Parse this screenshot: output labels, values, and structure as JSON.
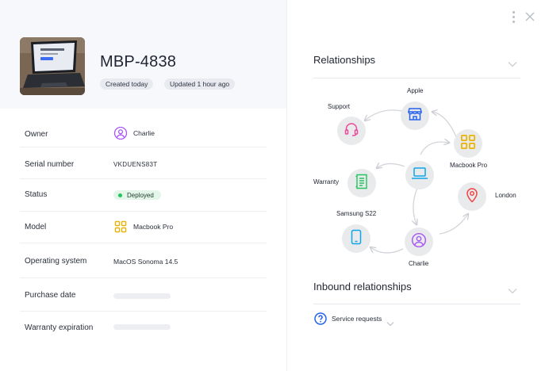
{
  "asset": {
    "title": "MBP-4838",
    "created_label": "Created today",
    "updated_label": "Updated 1 hour ago"
  },
  "fields": [
    {
      "label": "Owner",
      "value": "Charlie",
      "icon": "user-circle-icon"
    },
    {
      "label": "Serial number",
      "value": "VKDUENS83T"
    },
    {
      "label": "Status",
      "value": "Deployed",
      "status_color": "#22c55e"
    },
    {
      "label": "Model",
      "value": "Macbook Pro",
      "icon": "grid-icon"
    },
    {
      "label": "Operating system",
      "value": "MacOS Sonoma 14.5"
    },
    {
      "label": "Purchase date",
      "value": ""
    },
    {
      "label": "Warranty expiration",
      "value": ""
    }
  ],
  "relationships": {
    "title": "Relationships",
    "nodes": [
      {
        "label": "Apple",
        "icon": "store-icon"
      },
      {
        "label": "Support",
        "icon": "headset-icon"
      },
      {
        "label": "Macbook Pro",
        "icon": "grid-icon"
      },
      {
        "label": "Warranty",
        "icon": "document-icon"
      },
      {
        "label": "London",
        "icon": "location-pin-icon"
      },
      {
        "label": "Samsung S22",
        "icon": "phone-icon"
      },
      {
        "label": "Charlie",
        "icon": "user-circle-icon"
      },
      {
        "label": "",
        "icon": "laptop-icon"
      }
    ]
  },
  "inbound": {
    "title": "Inbound relationships",
    "items": [
      {
        "label": "Service requests",
        "icon": "question-circle-icon"
      }
    ]
  },
  "colors": {
    "accent_blue": "#2563eb",
    "purple": "#a855f7",
    "pink": "#ec4899",
    "yellow": "#eab308",
    "green": "#22c55e",
    "red": "#ef4444",
    "cyan": "#0ea5e9"
  }
}
